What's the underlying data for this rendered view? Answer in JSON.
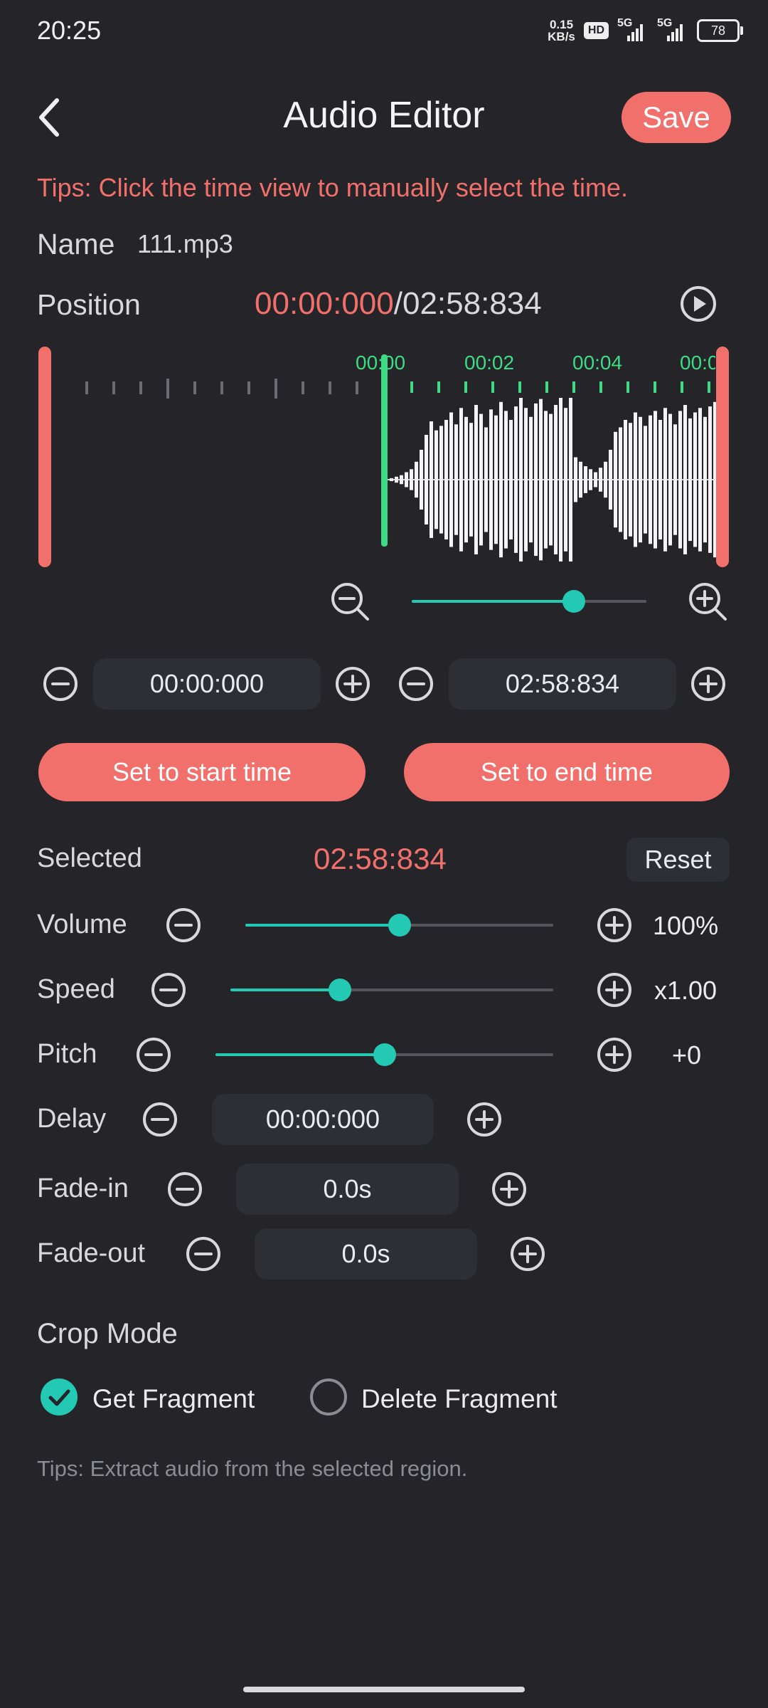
{
  "status": {
    "time": "20:25",
    "net_speed_value": "0.15",
    "net_speed_unit": "KB/s",
    "hd_badge": "HD",
    "sim1": "5G",
    "sim2": "5G",
    "battery": "78"
  },
  "header": {
    "title": "Audio Editor",
    "save_label": "Save"
  },
  "tips_top": "Tips: Click the time view to manually select the time.",
  "file": {
    "name_label": "Name",
    "name_value": "111.mp3"
  },
  "position": {
    "label": "Position",
    "current": "00:00:000",
    "separator": "/",
    "total": "02:58:834"
  },
  "timeline": {
    "tick_labels": [
      "00:00",
      "00:02",
      "00:04",
      "00:0"
    ]
  },
  "zoom": {
    "level": 0.69
  },
  "range": {
    "start": "00:00:000",
    "end": "02:58:834"
  },
  "buttons": {
    "set_start": "Set to start time",
    "set_end": "Set to end time",
    "reset": "Reset"
  },
  "selected": {
    "label": "Selected",
    "value": "02:58:834"
  },
  "controls": {
    "volume": {
      "label": "Volume",
      "value": "100%",
      "level": 0.5
    },
    "speed": {
      "label": "Speed",
      "value": "x1.00",
      "level": 0.34
    },
    "pitch": {
      "label": "Pitch",
      "value": "+0",
      "level": 0.5
    },
    "delay": {
      "label": "Delay",
      "value": "00:00:000"
    },
    "fade_in": {
      "label": "Fade-in",
      "value": "0.0s"
    },
    "fade_out": {
      "label": "Fade-out",
      "value": "0.0s"
    }
  },
  "crop": {
    "label": "Crop Mode",
    "option_get": "Get Fragment",
    "option_delete": "Delete Fragment",
    "selected": "Get Fragment"
  },
  "tips_bottom": "Tips: Extract audio from the selected region.",
  "colors": {
    "accent": "#f2706c",
    "teal": "#23c9b3",
    "green": "#3ddc84",
    "background": "#242429",
    "field": "#2e2e35"
  },
  "icons": {
    "back": "chevron-left-icon",
    "play": "play-circle-icon",
    "zoom_out": "zoom-out-icon",
    "zoom_in": "zoom-in-icon",
    "minus": "minus-circle-icon",
    "plus": "plus-circle-icon",
    "check": "check-circle-icon",
    "radio": "radio-empty-icon"
  }
}
